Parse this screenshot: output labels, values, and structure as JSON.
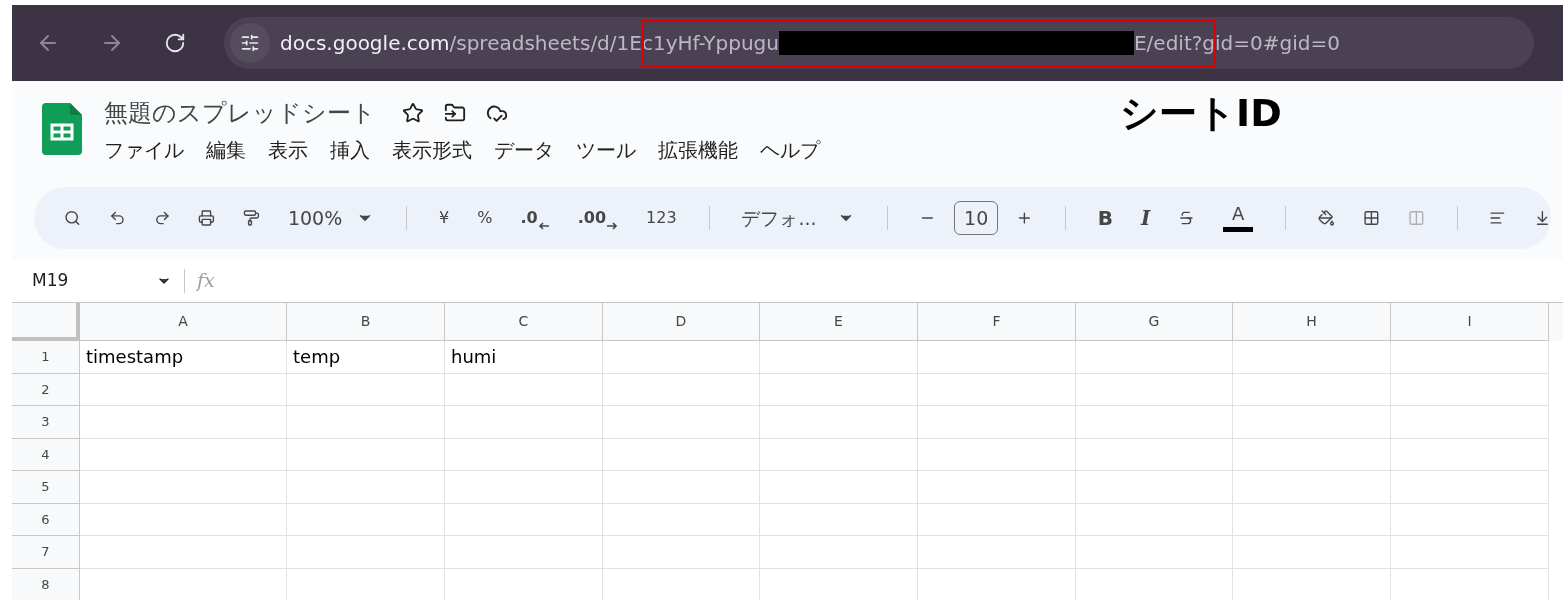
{
  "browser": {
    "url_host": "docs.google.com",
    "url_path_start": "/spreadsheets/d/",
    "url_id_start": "1Ec1yHf-Yppugu",
    "url_id_end": "E",
    "url_rest": "/edit?gid=0#gid=0"
  },
  "annotation": {
    "label": "シートID"
  },
  "document": {
    "title": "無題のスプレッドシート",
    "menu": [
      "ファイル",
      "編集",
      "表示",
      "挿入",
      "表示形式",
      "データ",
      "ツール",
      "拡張機能",
      "ヘルプ"
    ]
  },
  "toolbar": {
    "zoom": "100%",
    "currency": "¥",
    "percent": "%",
    "decrease_decimal": ".0",
    "increase_decimal": ".00",
    "number_format": "123",
    "font": "デフォ...",
    "font_size": "10",
    "bold": "B",
    "italic": "I",
    "text_color": "A"
  },
  "formula_bar": {
    "name_box": "M19",
    "fx": "fx"
  },
  "sheet": {
    "columns": [
      "A",
      "B",
      "C",
      "D",
      "E",
      "F",
      "G",
      "H",
      "I"
    ],
    "rows": [
      {
        "number": "1",
        "cells": [
          "timestamp",
          "temp",
          "humi"
        ]
      },
      {
        "number": "2",
        "cells": []
      },
      {
        "number": "3",
        "cells": []
      },
      {
        "number": "4",
        "cells": []
      },
      {
        "number": "5",
        "cells": []
      },
      {
        "number": "6",
        "cells": []
      },
      {
        "number": "7",
        "cells": []
      },
      {
        "number": "8",
        "cells": []
      }
    ]
  }
}
